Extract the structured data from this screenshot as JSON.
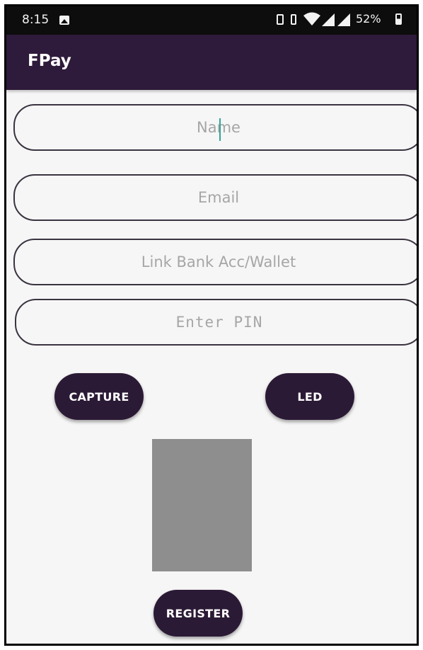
{
  "status_bar": {
    "time": "8:15",
    "battery": "52%",
    "icons": [
      "gallery-icon",
      "phone-icon",
      "vibrate-icon",
      "wifi-icon",
      "signal-icon",
      "signal-icon",
      "battery-icon"
    ]
  },
  "app_bar": {
    "title": "FPay"
  },
  "form": {
    "name_placeholder": "Name",
    "email_placeholder": "Email",
    "bank_placeholder": "Link Bank Acc/Wallet",
    "pin_placeholder": "Enter PIN"
  },
  "buttons": {
    "capture": "CAPTURE",
    "led": "LED",
    "register": "REGISTER"
  },
  "colors": {
    "app_bar": "#2e1a3a",
    "button": "#2b1a35",
    "preview": "#8e8e8e",
    "cursor": "#2fa59a"
  }
}
